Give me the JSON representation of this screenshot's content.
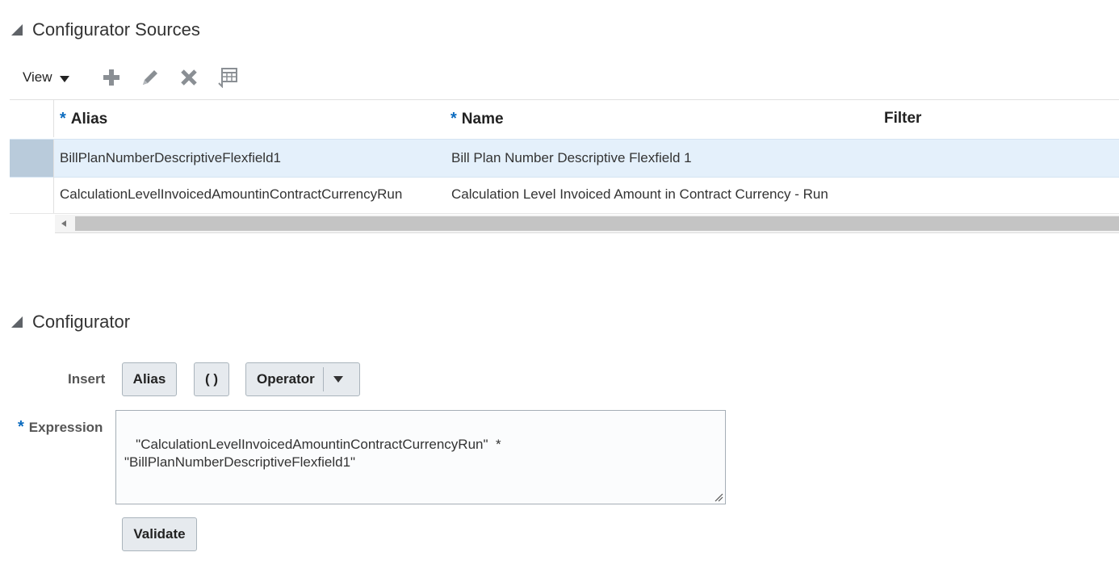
{
  "sources": {
    "title": "Configurator Sources",
    "toolbar": {
      "view_label": "View",
      "icons": [
        "add-icon",
        "edit-icon",
        "delete-icon",
        "freeze-columns-icon"
      ]
    },
    "table": {
      "columns": [
        {
          "label": "Alias",
          "required": "*"
        },
        {
          "label": "Name",
          "required": "*"
        },
        {
          "label": "Filter",
          "required": ""
        }
      ],
      "rows": [
        {
          "alias": "BillPlanNumberDescriptiveFlexfield1",
          "name": "Bill Plan Number Descriptive Flexfield 1",
          "filter": ""
        },
        {
          "alias": "CalculationLevelInvoicedAmountinContractCurrencyRun",
          "name": "Calculation Level Invoiced Amount in Contract Currency - Run",
          "filter": ""
        }
      ]
    }
  },
  "configurator": {
    "title": "Configurator",
    "insert_label": "Insert",
    "alias_button": "Alias",
    "paren_button": "( )",
    "operator_button": "Operator",
    "expression_required": "*",
    "expression_label": "Expression",
    "expression_value": " \"CalculationLevelInvoicedAmountinContractCurrencyRun\"  *\n\"BillPlanNumberDescriptiveFlexfield1\"",
    "validate_button": "Validate"
  }
}
